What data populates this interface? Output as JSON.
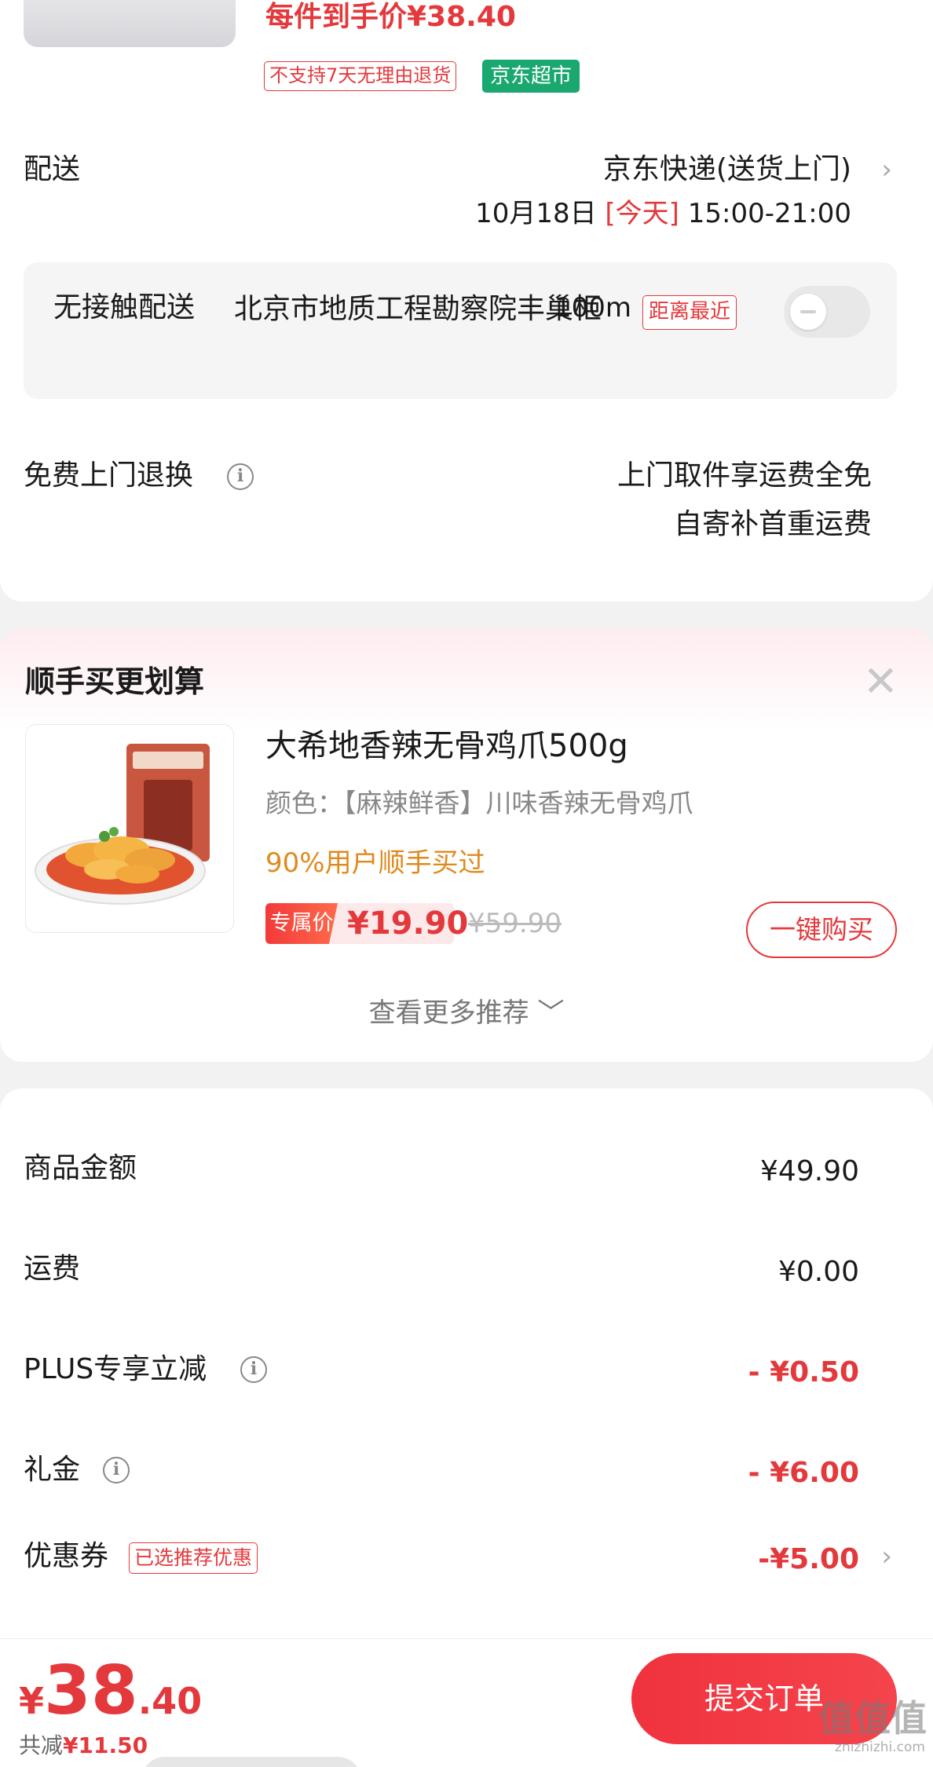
{
  "product": {
    "unit_price_text": "每件到手价¥38.40",
    "tag_no_return": "不支持7天无理由退货",
    "tag_store": "京东超市"
  },
  "delivery": {
    "label": "配送",
    "method": "京东快递(送货上门)",
    "date": "10月18日 ",
    "today": "[今天]",
    "window": " 15:00-21:00"
  },
  "contactless": {
    "label": "无接触配送",
    "location": "北京市地质工程勘察院丰巢柜",
    "distance": "100m",
    "badge": "距离最近",
    "toggle_on": false
  },
  "returns": {
    "label": "免费上门退换",
    "line1": "上门取件享运费全免",
    "line2": "自寄补首重运费"
  },
  "addon": {
    "title": "顺手买更划算",
    "product_name": "大希地香辣无骨鸡爪500g",
    "spec": "颜色：【麻辣鲜香】川味香辣无骨鸡爪",
    "social_proof": "90%用户顺手买过",
    "price_tag": "专属价",
    "price": "¥19.90",
    "old_price": "¥59.90",
    "buy_label": "一键购买",
    "more_label": "查看更多推荐 ﹀"
  },
  "summary": {
    "rows": [
      {
        "label": "商品金额",
        "value": "¥49.90"
      },
      {
        "label": "运费",
        "value": "¥0.00"
      },
      {
        "label": "PLUS专享立减",
        "value": "- ¥0.50"
      },
      {
        "label": "礼金",
        "value": "- ¥6.00"
      },
      {
        "label": "优惠券",
        "value": "-¥5.00"
      }
    ],
    "coupon_tag": "已选推荐优惠"
  },
  "bottom": {
    "currency": "¥",
    "total_int": "38",
    "total_dec": ".40",
    "saved_label": "共减",
    "saved_amount": "¥11.50",
    "submit_label": "提交订单",
    "watermark": "值值值",
    "watermark_url": "zhizhizhi.com"
  },
  "colors": {
    "accent": "#e4393c",
    "store_green": "#1aa870",
    "social_orange": "#e08a1e"
  }
}
